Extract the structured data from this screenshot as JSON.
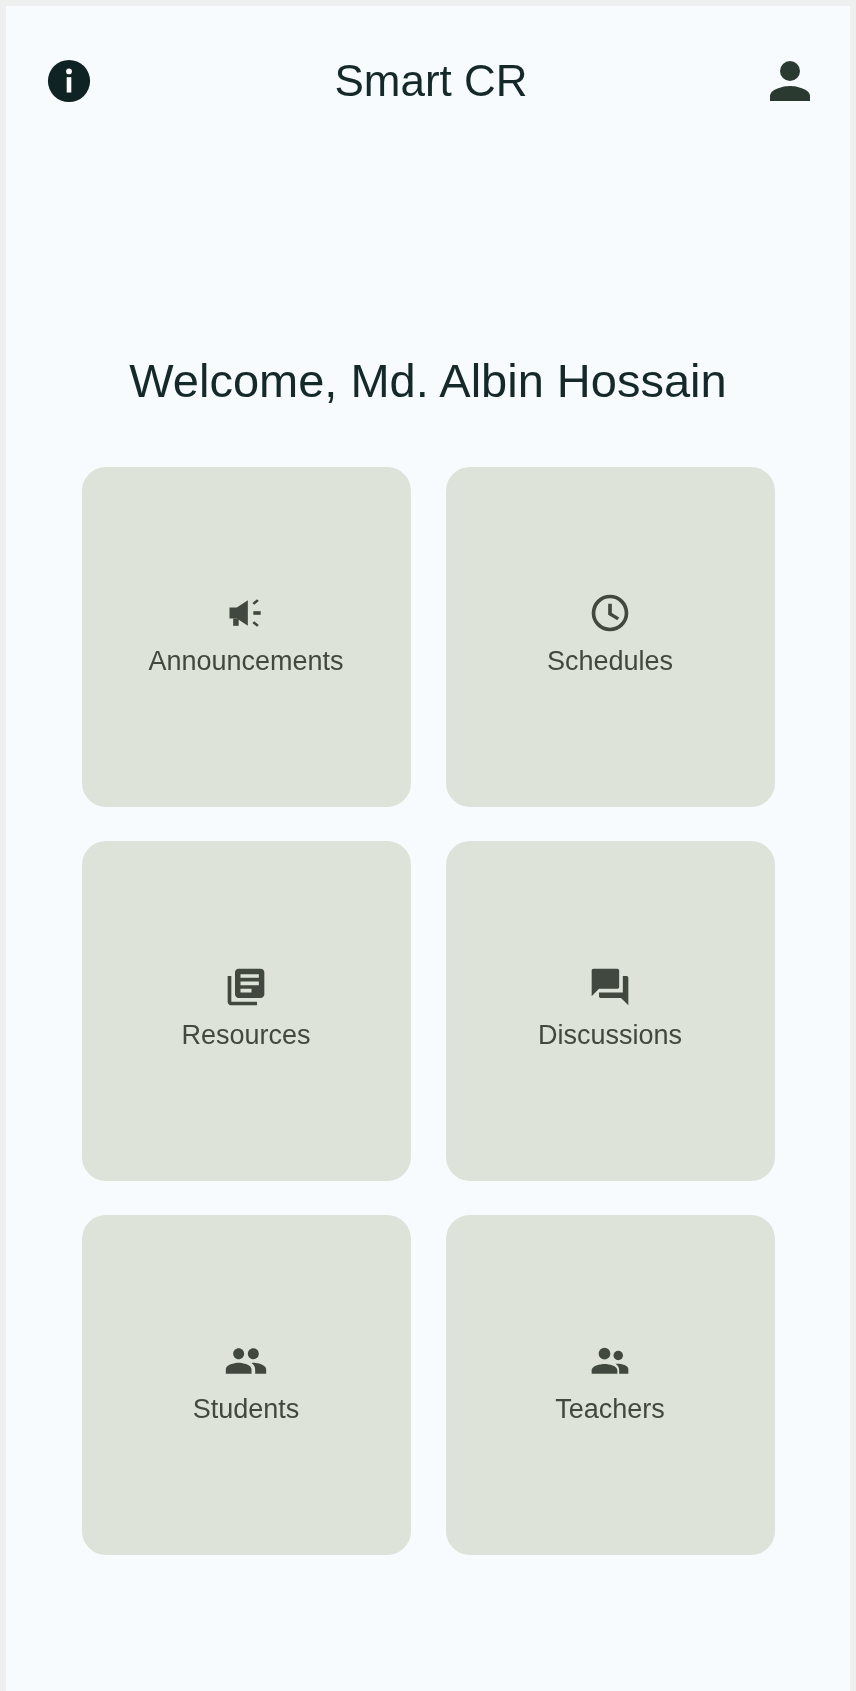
{
  "app_bar": {
    "title": "Smart CR"
  },
  "welcome": "Welcome, Md. Albin Hossain",
  "tiles": [
    {
      "kind": "megaphone",
      "label": "Announcements"
    },
    {
      "kind": "clock",
      "label": "Schedules"
    },
    {
      "kind": "library",
      "label": "Resources"
    },
    {
      "kind": "forum",
      "label": "Discussions"
    },
    {
      "kind": "people",
      "label": "Students"
    },
    {
      "kind": "teachers",
      "label": "Teachers"
    }
  ]
}
